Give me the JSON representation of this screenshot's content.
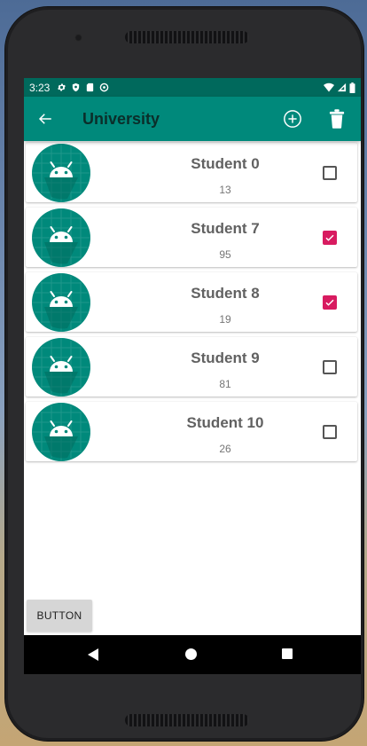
{
  "statusbar": {
    "time": "3:23"
  },
  "appbar": {
    "title": "University"
  },
  "students": [
    {
      "name": "Student 0",
      "score": "13",
      "checked": false
    },
    {
      "name": "Student 7",
      "score": "95",
      "checked": true
    },
    {
      "name": "Student 8",
      "score": "19",
      "checked": true
    },
    {
      "name": "Student 9",
      "score": "81",
      "checked": false
    },
    {
      "name": "Student 10",
      "score": "26",
      "checked": false
    }
  ],
  "footer": {
    "button_label": "BUTTON"
  },
  "icons": {
    "back": "arrow-back-icon",
    "add": "add-circle-icon",
    "delete": "trash-icon",
    "avatar": "android-icon",
    "checkbox": "checkbox-icon"
  },
  "colors": {
    "statusbar": "#00695c",
    "appbar": "#00897b",
    "accent": "#d81b60",
    "avatar_bg": "#00897b"
  }
}
